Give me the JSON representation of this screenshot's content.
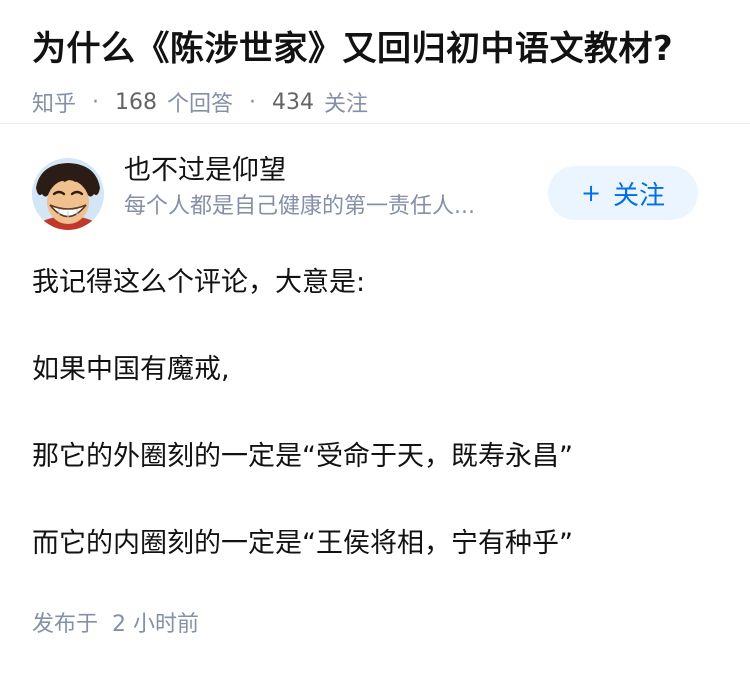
{
  "question": {
    "title": "为什么《陈涉世家》又回归初中语文教材?",
    "source": "知乎",
    "separator": "·",
    "answer_count": "168",
    "answer_label": "个回答",
    "follower_count": "434",
    "follower_label": "关注"
  },
  "author": {
    "name": "也不过是仰望",
    "bio": "每个人都是自己健康的第一责任人...",
    "avatar_icon": "cartoon-avatar-icon",
    "follow_icon": "plus-icon",
    "follow_symbol": "+",
    "follow_label": "关注"
  },
  "answer": {
    "paragraphs": [
      "我记得这么个评论，大意是:",
      "如果中国有魔戒,",
      "那它的外圈刻的一定是“受命于天，既寿永昌”",
      "而它的内圈刻的一定是“王侯将相，宁有种乎”"
    ],
    "published": "发布于  2 小时前"
  },
  "colors": {
    "meta_gray": "#8590a6",
    "accent_blue": "#056de8",
    "follow_bg": "#ebf5ff",
    "text": "#121212"
  }
}
